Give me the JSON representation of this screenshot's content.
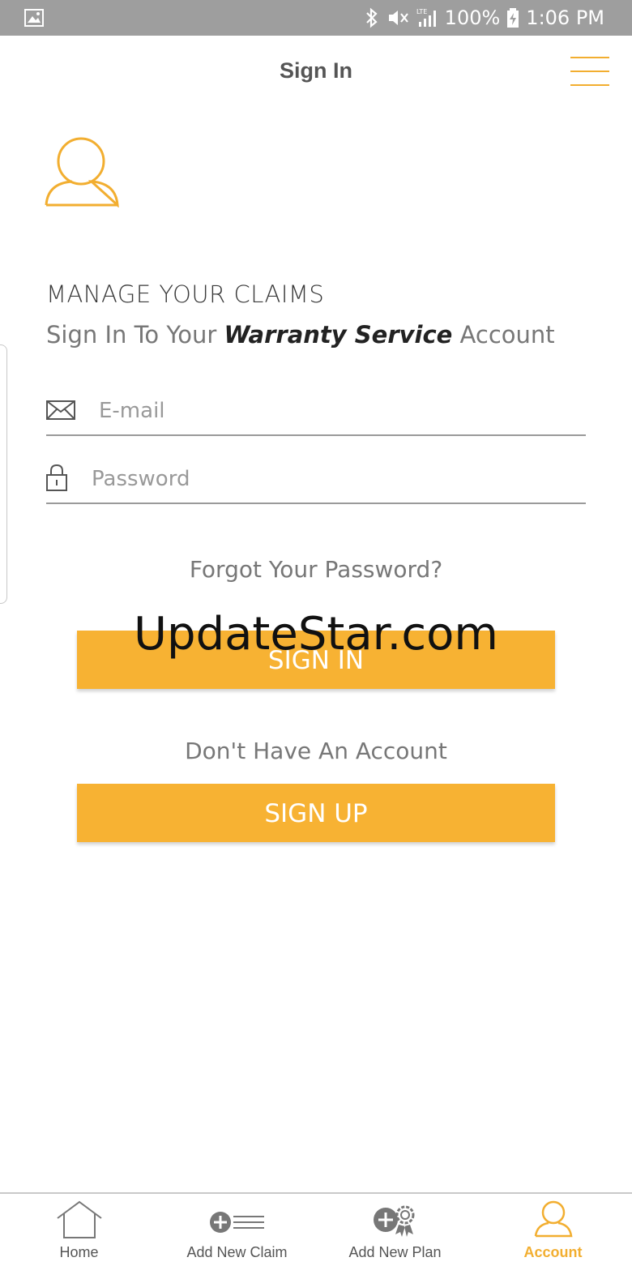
{
  "status_bar": {
    "battery": "100%",
    "time": "1:06 PM",
    "network": "LTE"
  },
  "header": {
    "title": "Sign In"
  },
  "content": {
    "heading": "MANAGE YOUR CLAIMS",
    "subheading_prefix": "Sign In To Your ",
    "subheading_brand": "Warranty Service",
    "subheading_suffix": " Account",
    "email_placeholder": "E-mail",
    "password_placeholder": "Password",
    "forgot_link": "Forgot Your Password?",
    "signin_label": "SIGN IN",
    "no_account_text": "Don't Have An Account",
    "signup_label": "SIGN UP",
    "watermark": "UpdateStar.com"
  },
  "bottom_nav": {
    "items": [
      {
        "label": "Home",
        "icon": "home-icon"
      },
      {
        "label": "Add New Claim",
        "icon": "add-claim-icon"
      },
      {
        "label": "Add New Plan",
        "icon": "add-plan-icon"
      },
      {
        "label": "Account",
        "icon": "account-icon"
      }
    ],
    "active": "Account"
  },
  "colors": {
    "accent": "#f7b233",
    "status_bar": "#9e9e9e"
  }
}
